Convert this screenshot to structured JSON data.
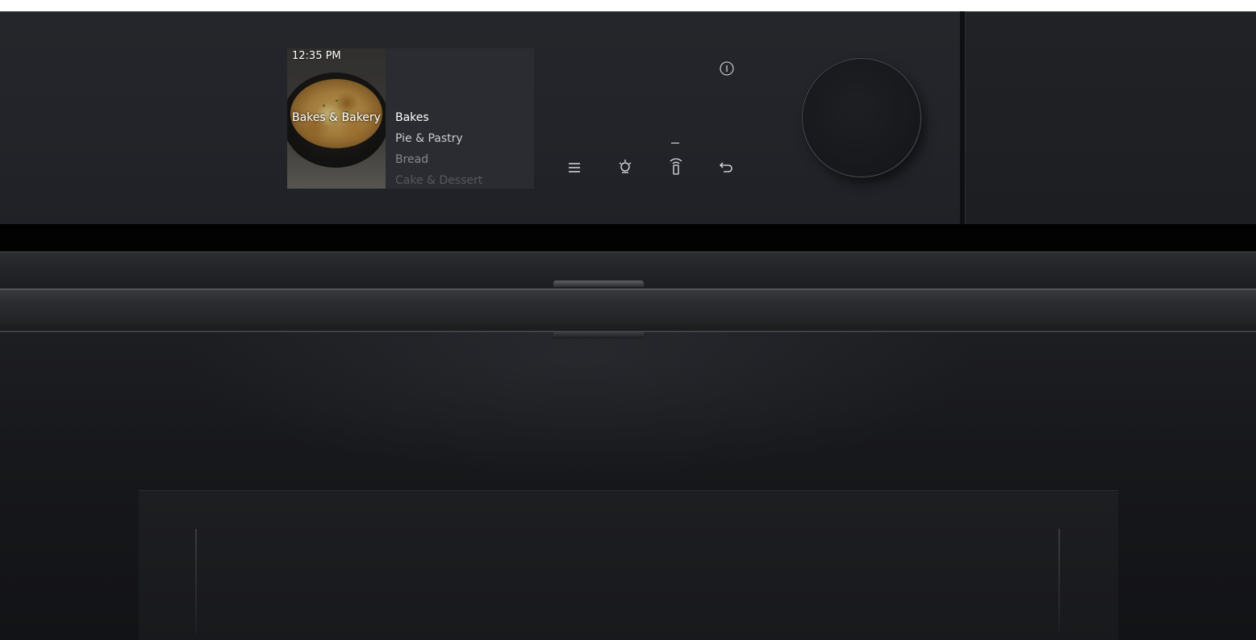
{
  "display": {
    "time": "12:35 PM",
    "category": "Bakes & Bakery",
    "menu_items": [
      "Bakes",
      "Pie & Pastry",
      "Bread",
      "Cake & Dessert"
    ]
  },
  "controls": {
    "buttons": [
      {
        "name": "menu",
        "icon": "menu-icon"
      },
      {
        "name": "light",
        "icon": "light-bulb-icon"
      },
      {
        "name": "remote",
        "icon": "remote-control-icon"
      },
      {
        "name": "back",
        "icon": "back-arrow-icon"
      },
      {
        "name": "info",
        "icon": "info-icon"
      }
    ],
    "knob": "control-knob"
  },
  "colors": {
    "panel": "#232529",
    "display_bg": "#2a2c31",
    "text_primary": "#ffffff",
    "text_secondary": "#c9cbcf",
    "text_dim": "#85888e"
  }
}
